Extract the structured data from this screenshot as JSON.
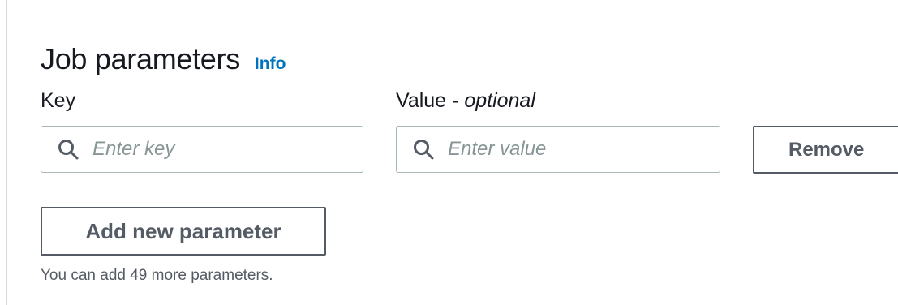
{
  "section": {
    "title": "Job parameters",
    "info_link": "Info"
  },
  "fields": {
    "key_label": "Key",
    "value_label": "Value - ",
    "value_label_suffix": "optional",
    "key_input": {
      "value": "",
      "placeholder": "Enter key"
    },
    "value_input": {
      "value": "",
      "placeholder": "Enter value"
    }
  },
  "buttons": {
    "remove": "Remove",
    "add_parameter": "Add new parameter"
  },
  "hint_text": "You can add 49 more parameters.",
  "colors": {
    "link": "#0073bb",
    "text": "#16191f",
    "border": "#aab7b8",
    "button_border": "#545b64",
    "placeholder": "#879596"
  },
  "icons": {
    "search": "search-icon"
  }
}
